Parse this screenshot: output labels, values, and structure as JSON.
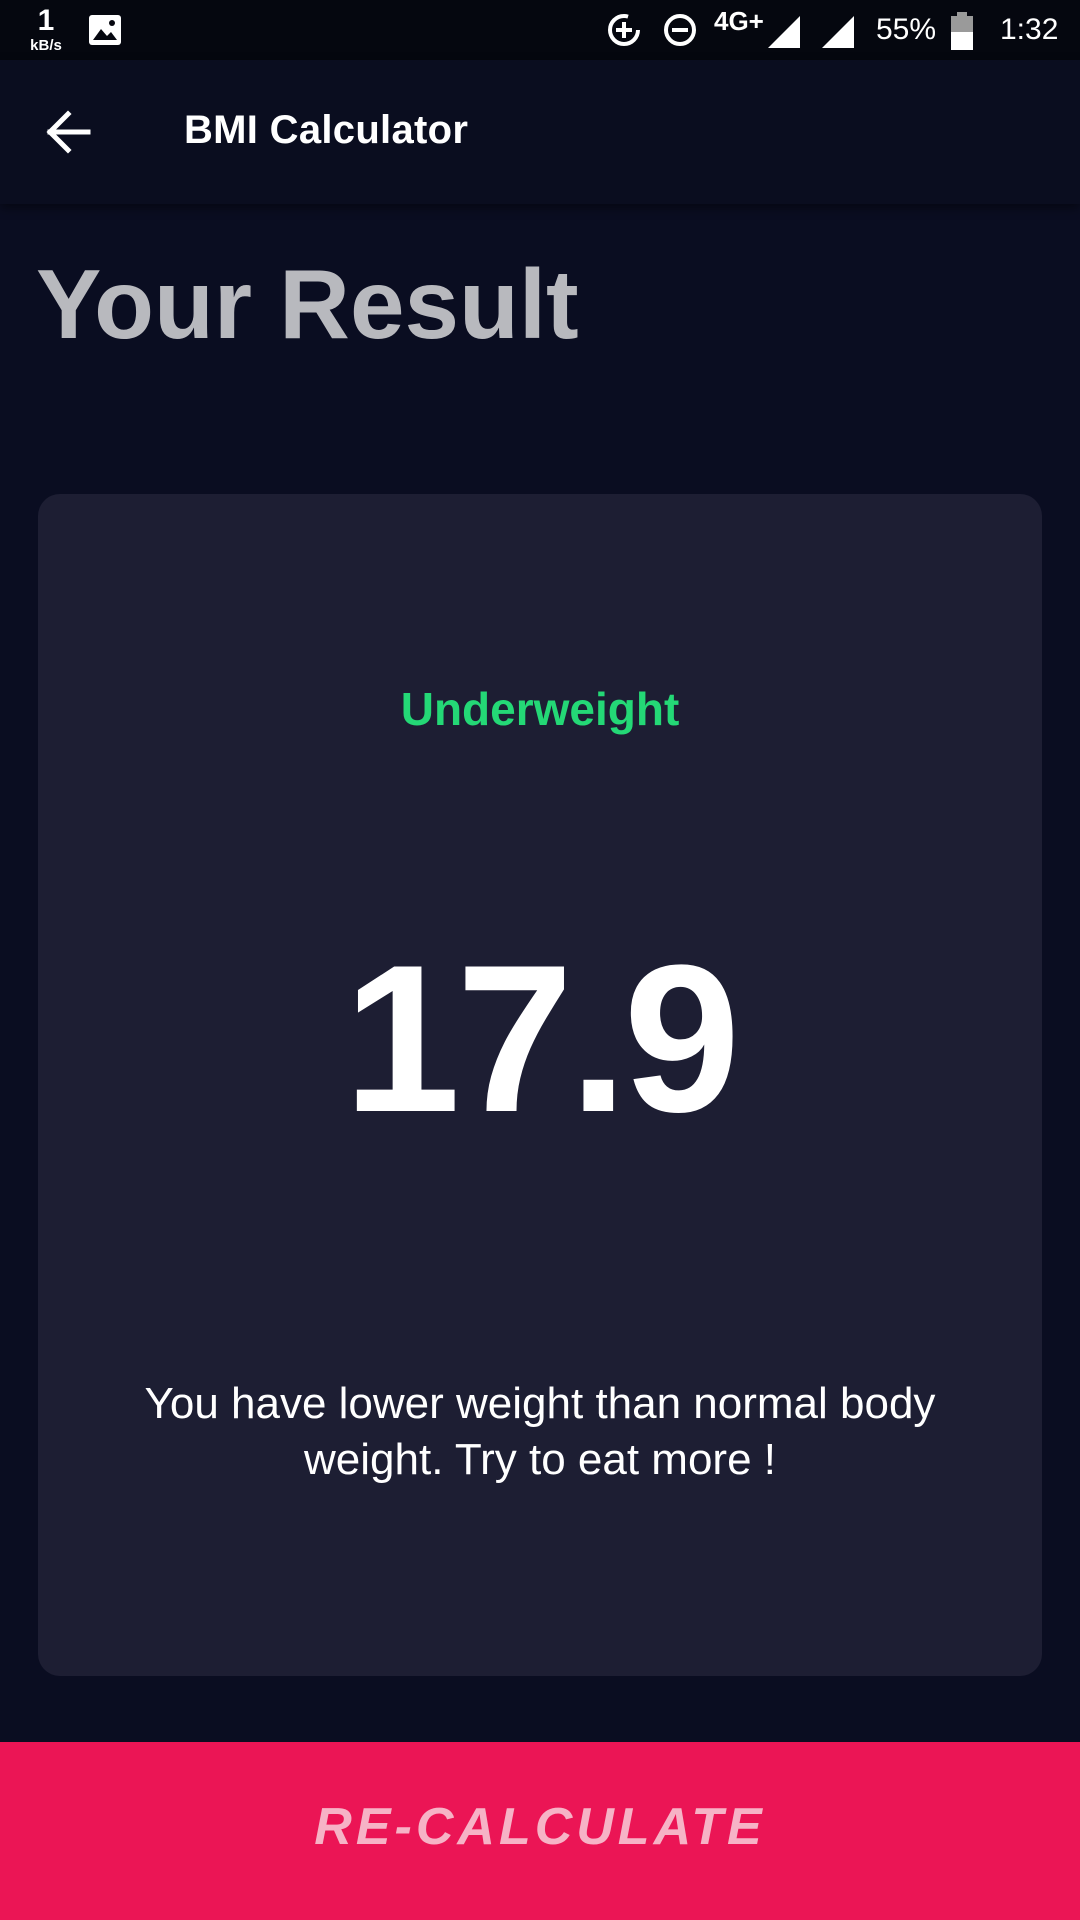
{
  "status_bar": {
    "net_speed_value": "1",
    "net_speed_unit": "kB/s",
    "network_type": "4G+",
    "battery_percent": "55%",
    "time": "1:32",
    "icons": [
      "image-icon",
      "data-saver-icon",
      "do-not-disturb-icon",
      "signal-icon",
      "signal-icon",
      "battery-icon"
    ]
  },
  "app_bar": {
    "back_icon": "arrow-left-icon",
    "title": "BMI Calculator"
  },
  "page": {
    "title": "Your Result"
  },
  "result": {
    "category": "Underweight",
    "category_color": "#24d876",
    "bmi_value": "17.9",
    "advice": "You have lower weight than normal body weight. Try to eat more !"
  },
  "button": {
    "label": "RE-CALCULATE",
    "color": "#eb1555"
  }
}
